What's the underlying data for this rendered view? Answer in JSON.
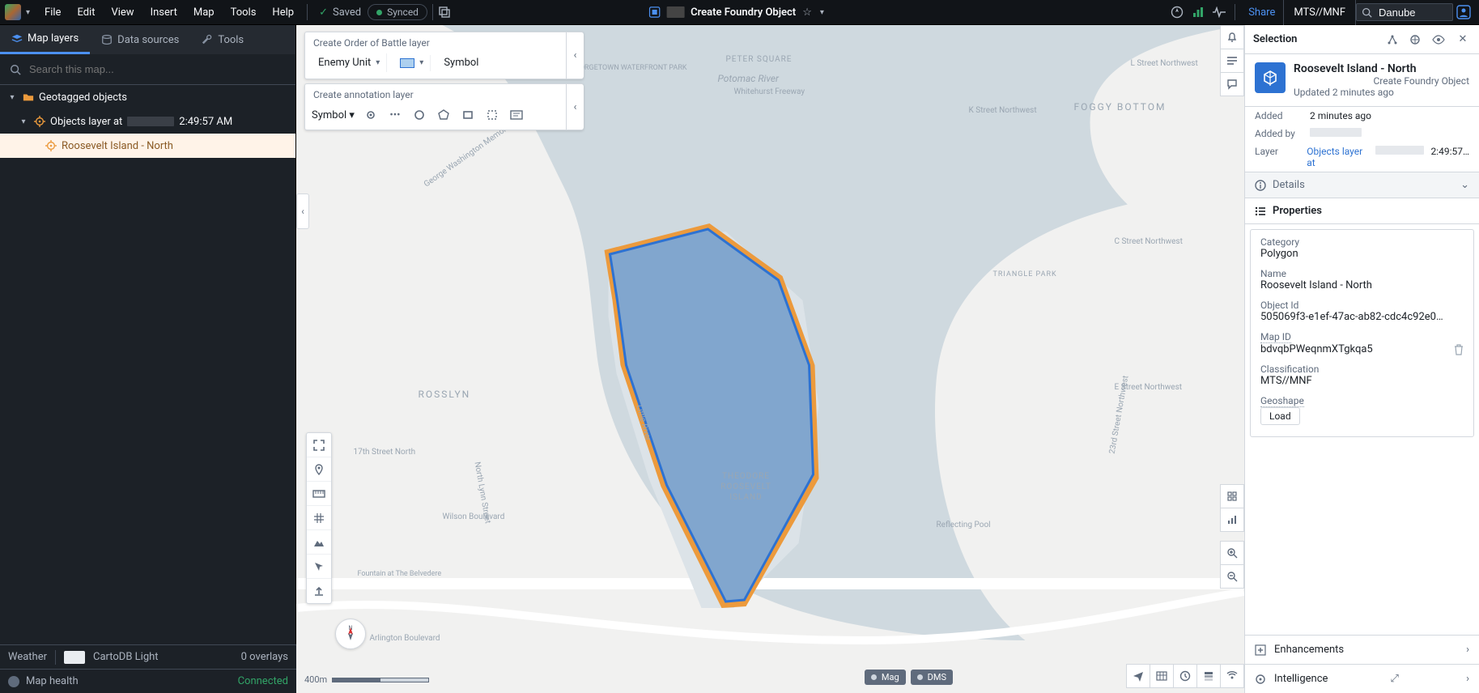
{
  "menubar": {
    "items": [
      "File",
      "Edit",
      "View",
      "Insert",
      "Map",
      "Tools",
      "Help"
    ],
    "saved": "Saved",
    "synced": "Synced",
    "title": "Create Foundry Object",
    "share": "Share",
    "classification": "MTS//MNF",
    "search_value": "Danube"
  },
  "left": {
    "tabs": {
      "layers": "Map layers",
      "sources": "Data sources",
      "tools": "Tools"
    },
    "search_placeholder": "Search this map...",
    "tree": {
      "root": "Geotagged objects",
      "layer_prefix": "Objects layer at",
      "layer_time": "2:49:57 AM",
      "selected": "Roosevelt Island - North"
    }
  },
  "float": {
    "oob_title": "Create Order of Battle layer",
    "oob_unit": "Enemy Unit",
    "oob_symbol": "Symbol",
    "anno_title": "Create annotation layer",
    "anno_symbol": "Symbol"
  },
  "map": {
    "basemap": "CartoDB Light",
    "weather": "Weather",
    "overlays": "0 overlays",
    "scale": "400m",
    "units_mag": "Mag",
    "units_dms": "DMS",
    "labels": {
      "potomac": "Potomac River",
      "island": "THEODORE ROOSEVELT ISLAND",
      "rosslyn": "ROSSLYN",
      "foggy": "FOGGY BOTTOM",
      "peter": "PETER SQUARE",
      "gtown": "GEORGETOWN WATERFRONT PARK",
      "whitehurst": "Whitehurst Freeway",
      "kstreet": "K Street Northwest",
      "lstreet": "L Street Northwest",
      "triangle": "TRIANGLE PARK",
      "gwpkwy": "George Washington Memorial Parkway",
      "little": "Little River",
      "wilson": "Wilson Boulevard",
      "arlington": "Arlington Boulevard",
      "reflecting": "Reflecting Pool",
      "estreet": "E Street Northwest",
      "cstreet": "C Street Northwest",
      "belvedere": "Fountain at The Belvedere",
      "nlynn": "North Lynn Street",
      "seventeenth": "17th Street North",
      "twentythird": "23rd Street Northwest"
    }
  },
  "status": {
    "map_health": "Map health",
    "connected": "Connected"
  },
  "selection": {
    "header": "Selection",
    "name": "Roosevelt Island - North",
    "source": "Create Foundry Object",
    "updated": "Updated 2 minutes ago",
    "added_k": "Added",
    "added_v": "2 minutes ago",
    "addedby_k": "Added by",
    "layer_k": "Layer",
    "layer_v_prefix": "Objects layer at",
    "layer_v_time": "2:49:57…",
    "details": "Details",
    "properties": "Properties",
    "props": {
      "category_k": "Category",
      "category_v": "Polygon",
      "name_k": "Name",
      "name_v": "Roosevelt Island - North",
      "oid_k": "Object Id",
      "oid_v": "505069f3-e1ef-47ac-ab82-cdc4c92e0…",
      "mapid_k": "Map ID",
      "mapid_v": "bdvqbPWeqnmXTgkqa5",
      "class_k": "Classification",
      "class_v": "MTS//MNF",
      "geo_k": "Geoshape",
      "load": "Load"
    },
    "enh": "Enhancements",
    "intel": "Intelligence"
  }
}
